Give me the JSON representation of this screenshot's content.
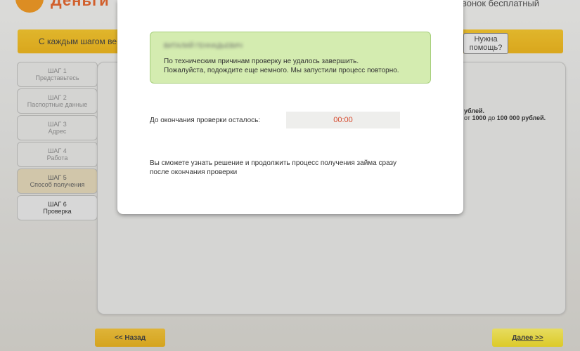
{
  "header": {
    "logo_icon": "brand-logo-icon",
    "logo_text": "Деньги",
    "call_text": "звонок бесплатный"
  },
  "banner": {
    "text": "С каждым шагом ве",
    "help_button": "Нужна\nпомощь?"
  },
  "steps": [
    {
      "title": "ШАГ 1",
      "subtitle": "Представьтесь"
    },
    {
      "title": "ШАГ 2",
      "subtitle": "Паспортные данные"
    },
    {
      "title": "ШАГ 3",
      "subtitle": "Адрес"
    },
    {
      "title": "ШАГ 4",
      "subtitle": "Работа"
    },
    {
      "title": "ШАГ 5",
      "subtitle": "Способ получения"
    },
    {
      "title": "ШАГ 6",
      "subtitle": "Проверка"
    }
  ],
  "main": {
    "side_line1": "ублей.",
    "side_line2_prefix": "от",
    "side_line2_from": "1000",
    "side_line2_mid": "до",
    "side_line2_to": "100 000 рублей."
  },
  "modal": {
    "name": "ВИТАЛИЙ ГЕННАДЬЕВИЧ",
    "notice_text": "По техническим причинам проверку не удалось завершить.\nПожалуйста, подождите еще немного. Мы запустили процесс повторно.",
    "timer_label": "До окончания проверки осталось:",
    "timer_value": "00:00",
    "info_text": "Вы сможете узнать решение и продолжить процесс получения займа сразу\nпосле окончания проверки"
  },
  "nav": {
    "back_label": "<< Назад",
    "next_label": "Далее >>"
  },
  "colors": {
    "accent_yellow": "#f7c31b",
    "notice_green": "#d4ecb0",
    "timer_red": "#d64a2e",
    "brand_orange": "#e55a1b"
  }
}
